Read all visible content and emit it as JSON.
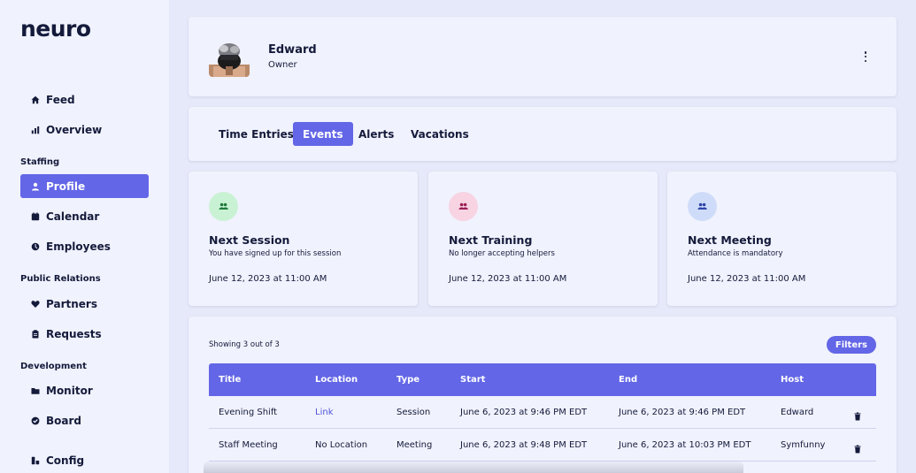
{
  "brand": {
    "logo": "neuro"
  },
  "sidebar": {
    "items": [
      {
        "label": "Feed",
        "icon": "home-icon"
      },
      {
        "label": "Overview",
        "icon": "bar-chart-icon"
      }
    ],
    "sections": [
      {
        "title": "Staffing",
        "items": [
          {
            "label": "Profile",
            "icon": "user-icon",
            "active": true
          },
          {
            "label": "Calendar",
            "icon": "calendar-icon"
          },
          {
            "label": "Employees",
            "icon": "clock-icon"
          }
        ]
      },
      {
        "title": "Public Relations",
        "items": [
          {
            "label": "Partners",
            "icon": "heart-icon"
          },
          {
            "label": "Requests",
            "icon": "clipboard-icon"
          }
        ]
      },
      {
        "title": "Development",
        "items": [
          {
            "label": "Monitor",
            "icon": "folder-icon"
          },
          {
            "label": "Board",
            "icon": "check-circle-icon"
          }
        ]
      }
    ],
    "footer_item": {
      "label": "Config",
      "icon": "settings-icon"
    }
  },
  "profile": {
    "name": "Edward",
    "role": "Owner"
  },
  "tabs": [
    {
      "label": "Time Entries"
    },
    {
      "label": "Events",
      "active": true
    },
    {
      "label": "Alerts"
    },
    {
      "label": "Vacations"
    }
  ],
  "event_cards": [
    {
      "title": "Next Session",
      "subtitle": "You have signed up for this session",
      "date": "June 12, 2023 at 11:00 AM",
      "icon_bg": "#c9f2d4",
      "icon_color": "#1f7a3a"
    },
    {
      "title": "Next Training",
      "subtitle": "No longer accepting helpers",
      "date": "June 12, 2023 at 11:00 AM",
      "icon_bg": "#f8d3e2",
      "icon_color": "#9b1f55"
    },
    {
      "title": "Next Meeting",
      "subtitle": "Attendance is mandatory",
      "date": "June 12, 2023 at 11:00 AM",
      "icon_bg": "#cfdcf9",
      "icon_color": "#2f45a8"
    }
  ],
  "events_table": {
    "showing": "Showing 3 out of 3",
    "filters_label": "Filters",
    "columns": [
      "Title",
      "Location",
      "Type",
      "Start",
      "End",
      "Host"
    ],
    "rows": [
      {
        "title": "Evening Shift",
        "location": "Link",
        "type": "Session",
        "start": "June 6, 2023 at 9:46 PM EDT",
        "end": "June 6, 2023 at 9:46 PM EDT",
        "host": "Edward"
      },
      {
        "title": "Staff Meeting",
        "location": "No Location",
        "type": "Meeting",
        "start": "June 6, 2023 at 9:48 PM EDT",
        "end": "June 6, 2023 at 10:03 PM EDT",
        "host": "Symfunny"
      }
    ]
  },
  "colors": {
    "accent": "#6366e6",
    "page_bg": "#e6e9fa",
    "card_bg": "#f0f2fd",
    "text": "#141a3a"
  }
}
